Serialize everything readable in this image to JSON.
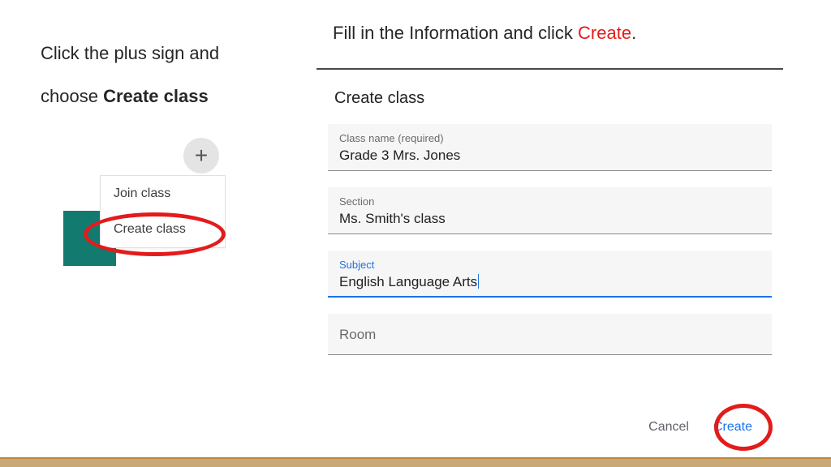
{
  "left": {
    "line1": "Click the plus sign and",
    "line2a": "choose ",
    "line2b": "Create class"
  },
  "right": {
    "prefix": "Fill in the Information and click ",
    "red": "Create",
    "suffix": "."
  },
  "plus_glyph": "+",
  "menu": {
    "join": "Join class",
    "create": "Create class"
  },
  "dialog": {
    "title": "Create class",
    "fields": {
      "classname": {
        "label": "Class name (required)",
        "value": "Grade 3 Mrs. Jones"
      },
      "section": {
        "label": "Section",
        "value": "Ms. Smith's class"
      },
      "subject": {
        "label": "Subject",
        "value": "English Language Arts"
      },
      "room": {
        "label": "Room",
        "value": ""
      }
    },
    "actions": {
      "cancel": "Cancel",
      "create": "Create"
    }
  }
}
